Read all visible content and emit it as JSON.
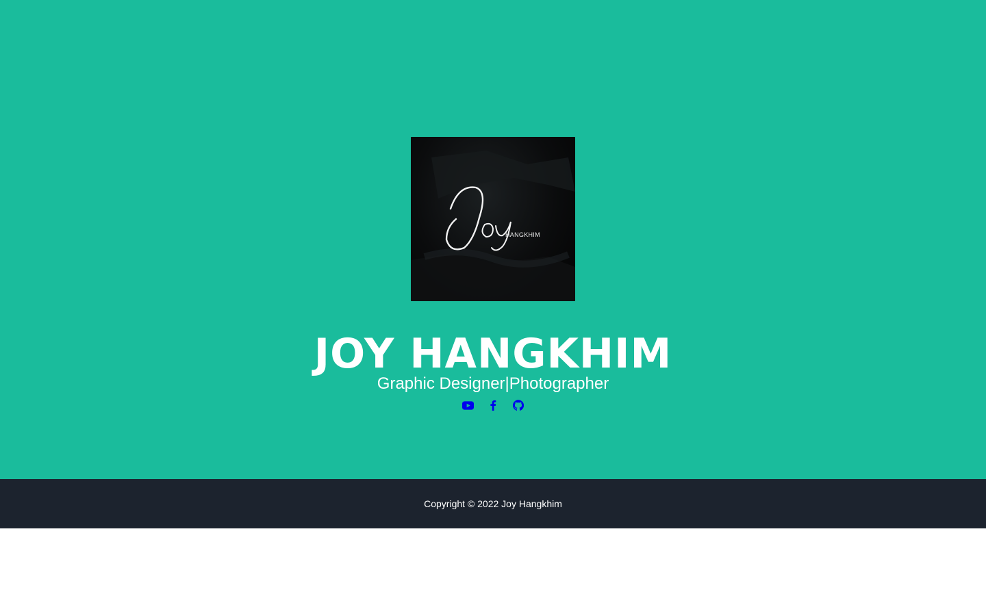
{
  "hero": {
    "logo": {
      "signature_text": "Joy",
      "wordmark": "HANGKHIM"
    },
    "title": "JOY HANGKHIM",
    "subtitle": "Graphic Designer|Photographer",
    "social_links": [
      {
        "icon": "youtube-icon"
      },
      {
        "icon": "facebook-icon"
      },
      {
        "icon": "github-icon"
      }
    ],
    "colors": {
      "background": "#1abc9c",
      "text": "#ffffff",
      "link": "#0000ee"
    }
  },
  "footer": {
    "copyright": "Copyright © 2022 Joy Hangkhim",
    "colors": {
      "background": "#1c232e",
      "text": "#ffffff"
    }
  }
}
